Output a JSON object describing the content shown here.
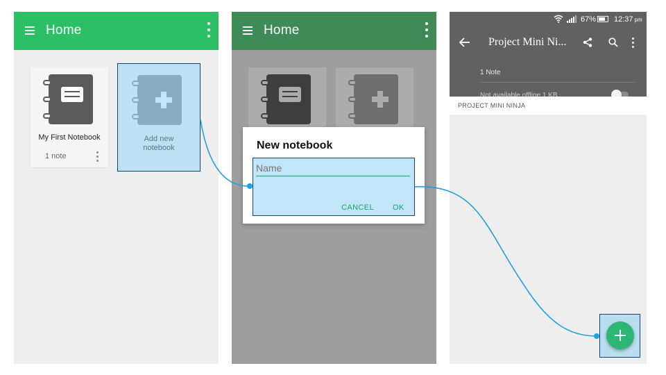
{
  "colors": {
    "accent_green": "#2dbf66",
    "accent_green_dim": "#3e8b58",
    "dialog_button": "#15a36a",
    "highlight": "#82cdf0",
    "connector": "#1ea0e6",
    "fab": "#2bb673",
    "toolbar_gray": "#616161"
  },
  "screen1": {
    "title": "Home",
    "notebook": {
      "name": "My First Notebook",
      "count": "1 note"
    },
    "add_card_label_line1": "Add new",
    "add_card_label_line2": "notebook"
  },
  "screen2": {
    "title": "Home",
    "dialog": {
      "title": "New notebook",
      "placeholder": "Name",
      "cancel": "CANCEL",
      "ok": "OK"
    }
  },
  "screen3": {
    "status": {
      "battery": "67%",
      "time": "12:37",
      "ampm": "pm"
    },
    "title": "Project Mini Ni...",
    "note_count": "1 Note",
    "offline_label": "Not available offline 1 KB",
    "section_header": "PROJECT MINI NINJA"
  },
  "icons": {
    "menu": "hamburger-icon",
    "overflow": "more-vert-icon",
    "notebook": "notebook-icon",
    "add": "plus-icon",
    "back": "arrow-left-icon",
    "share": "share-icon",
    "search": "search-icon",
    "wifi": "wifi-icon",
    "signal": "signal-icon",
    "battery": "battery-icon"
  }
}
